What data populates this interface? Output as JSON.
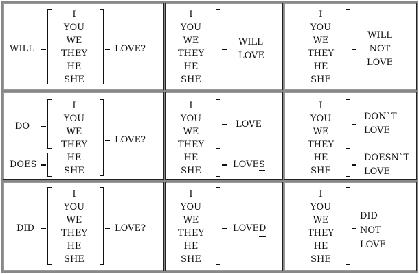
{
  "pronouns_all": [
    "I",
    "YOU",
    "WE",
    "THEY",
    "HE",
    "SHE"
  ],
  "pronouns_plural": [
    "I",
    "YOU",
    "WE",
    "THEY"
  ],
  "pronouns_singular": [
    "HE",
    "SHE"
  ],
  "future": {
    "question": {
      "aux": "WILL",
      "verb": "LOVE?"
    },
    "positive": {
      "line1": "WILL",
      "line2": "LOVE"
    },
    "negative": {
      "line1": "WILL",
      "line2": "NOT",
      "line3": "LOVE"
    }
  },
  "present": {
    "question": {
      "aux_plural": "DO",
      "aux_singular": "DOES",
      "verb": "LOVE?"
    },
    "positive": {
      "verb_plural": "LOVE",
      "verb_singular_stem": "LOVE",
      "verb_singular_ending": "S"
    },
    "negative": {
      "neg_plural_1": "DON`T",
      "neg_plural_2": "LOVE",
      "neg_singular_1": "DOESN`T",
      "neg_singular_2": "LOVE"
    }
  },
  "past": {
    "question": {
      "aux": "DID",
      "verb": "LOVE?"
    },
    "positive": {
      "verb_stem": "LOVE",
      "verb_ending": "D"
    },
    "negative": {
      "line1": "DID",
      "line2": "NOT",
      "line3": "LOVE"
    }
  }
}
